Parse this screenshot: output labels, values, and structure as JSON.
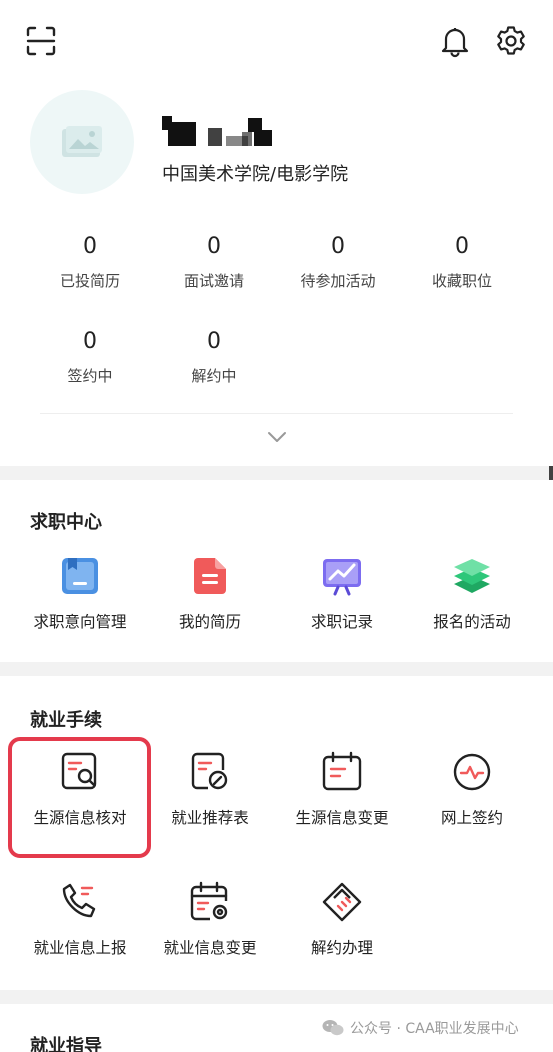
{
  "profile": {
    "school": "中国美术学院/电影学院",
    "stats": [
      {
        "value": "0",
        "label": "已投简历"
      },
      {
        "value": "0",
        "label": "面试邀请"
      },
      {
        "value": "0",
        "label": "待参加活动"
      },
      {
        "value": "0",
        "label": "收藏职位"
      },
      {
        "value": "0",
        "label": "签约中"
      },
      {
        "value": "0",
        "label": "解约中"
      }
    ]
  },
  "job_center": {
    "title": "求职中心",
    "items": [
      {
        "label": "求职意向管理",
        "icon": "bookmark-folder-icon",
        "color": "#4a90e2"
      },
      {
        "label": "我的简历",
        "icon": "resume-document-icon",
        "color": "#f05a5a"
      },
      {
        "label": "求职记录",
        "icon": "chart-record-icon",
        "color": "#7c6cf0"
      },
      {
        "label": "报名的活动",
        "icon": "layers-icon",
        "color": "#2ec77a"
      }
    ]
  },
  "procedures": {
    "title": "就业手续",
    "items": [
      {
        "label": "生源信息核对",
        "icon": "document-search-icon"
      },
      {
        "label": "就业推荐表",
        "icon": "document-edit-icon"
      },
      {
        "label": "生源信息变更",
        "icon": "calendar-document-icon"
      },
      {
        "label": "网上签约",
        "icon": "pulse-circle-icon"
      },
      {
        "label": "就业信息上报",
        "icon": "phone-report-icon"
      },
      {
        "label": "就业信息变更",
        "icon": "calendar-settings-icon"
      },
      {
        "label": "解约办理",
        "icon": "handshake-icon"
      }
    ]
  },
  "guidance": {
    "title": "就业指导"
  },
  "watermark": {
    "text": "公众号 · CAA职业发展中心"
  },
  "colors": {
    "accent": "#f05a5a",
    "highlight": "#e43a4c",
    "icon_stroke": "#222222"
  }
}
